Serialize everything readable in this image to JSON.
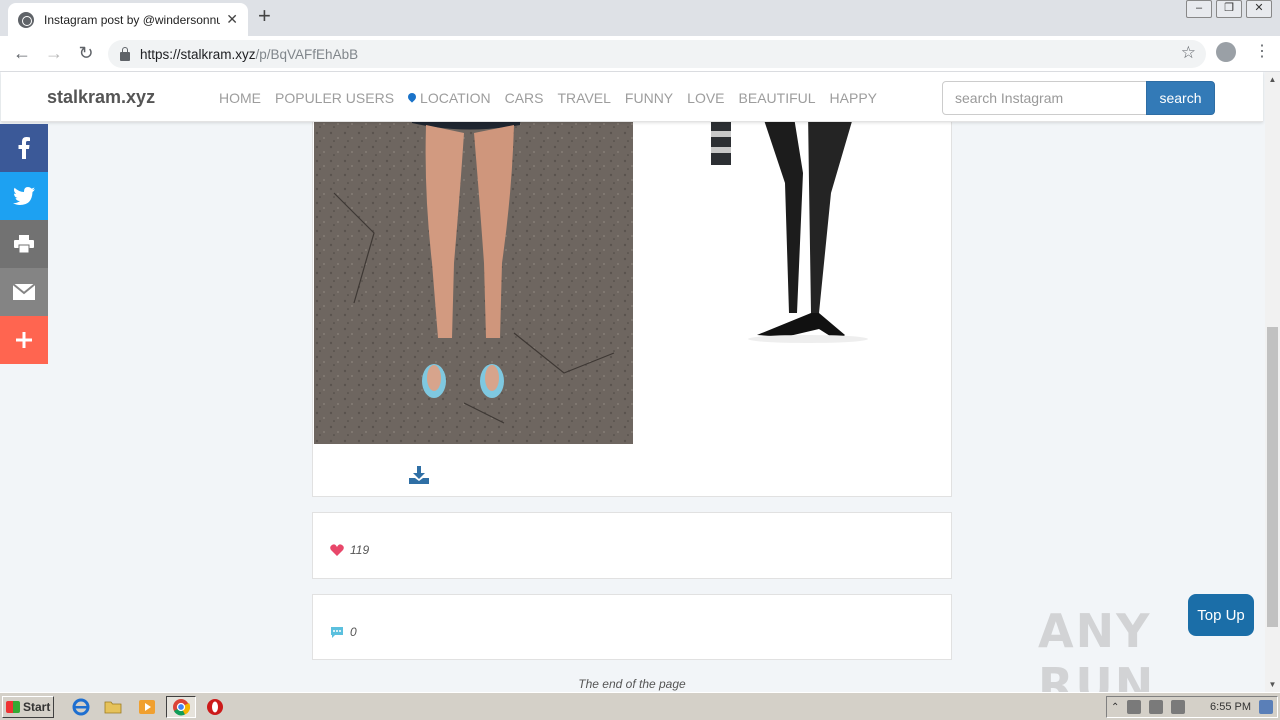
{
  "browser": {
    "tab_title": "Instagram post by @windersonnunes",
    "url_host": "https://stalkram.xyz",
    "url_path": "/p/BqVAFfEhAbB"
  },
  "site": {
    "brand": "stalkram.xyz",
    "nav": [
      "HOME",
      "POPULER USERS",
      "LOCATION",
      "CARS",
      "TRAVEL",
      "FUNNY",
      "LOVE",
      "BEAUTIFUL",
      "HAPPY"
    ],
    "search_placeholder": "search Instagram",
    "search_button": "search"
  },
  "post": {
    "likes": "119",
    "comments": "0",
    "end_text": "The end of the page",
    "top_up": "Top Up"
  },
  "colors": {
    "accent": "#337ab7",
    "facebook": "#3b5998",
    "twitter": "#1da1f2",
    "more": "#ff6550",
    "heart": "#e8476a",
    "comment": "#5bc0de"
  },
  "watermark": "ANY RUN",
  "taskbar": {
    "start": "Start",
    "clock": "6:55 PM"
  }
}
